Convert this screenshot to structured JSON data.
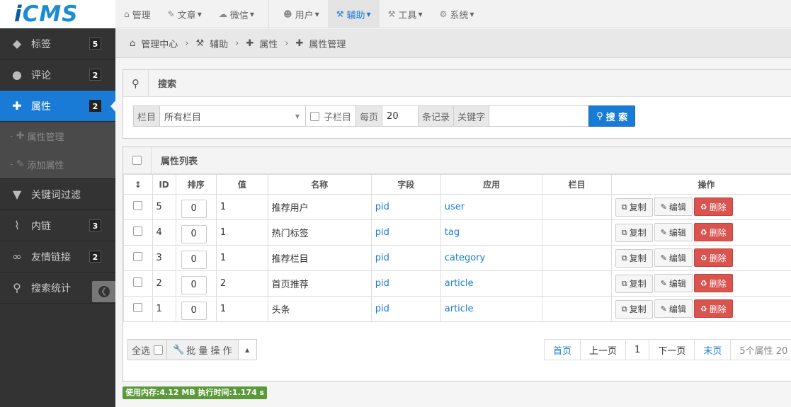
{
  "logo": {
    "text_i": "i",
    "text_cms": "CMS"
  },
  "nav": [
    {
      "icon": "home-icon",
      "glyph": "⌂",
      "label": "管理",
      "caret": false
    },
    {
      "icon": "edit-icon",
      "glyph": "✎",
      "label": "文章",
      "caret": true
    },
    {
      "icon": "wechat-icon",
      "glyph": "☁",
      "label": "微信",
      "caret": true
    },
    {
      "icon": "user-icon",
      "glyph": "☻",
      "label": "用户",
      "caret": true
    },
    {
      "icon": "gavel-icon",
      "glyph": "⚒",
      "label": "辅助",
      "caret": true,
      "active": true
    },
    {
      "icon": "tools-icon",
      "glyph": "⚒",
      "label": "工具",
      "caret": true
    },
    {
      "icon": "gear-icon",
      "glyph": "⚙",
      "label": "系统",
      "caret": true
    }
  ],
  "sidebar": {
    "items": [
      {
        "icon": "tags-icon",
        "glyph": "◆",
        "label": "标签",
        "badge": "5"
      },
      {
        "icon": "comments-icon",
        "glyph": "●",
        "label": "评论",
        "badge": "2"
      },
      {
        "icon": "puzzle-icon",
        "glyph": "✚",
        "label": "属性",
        "badge": "2",
        "active": true
      },
      {
        "icon": "filter-icon",
        "glyph": "▼",
        "label": "关键词过滤",
        "badge": ""
      },
      {
        "icon": "paperclip-icon",
        "glyph": "⌇",
        "label": "内链",
        "badge": "3"
      },
      {
        "icon": "link-icon",
        "glyph": "∞",
        "label": "友情链接",
        "badge": "2"
      },
      {
        "icon": "search-icon",
        "glyph": "⚲",
        "label": "搜索统计",
        "badge": ""
      }
    ],
    "sub": [
      {
        "icon": "puzzle-icon",
        "label": "属性管理"
      },
      {
        "icon": "edit-icon",
        "label": "添加属性"
      }
    ]
  },
  "breadcrumb": [
    {
      "icon": "home-icon",
      "glyph": "⌂",
      "label": "管理中心"
    },
    {
      "icon": "gavel-icon",
      "glyph": "⚒",
      "label": "辅助"
    },
    {
      "icon": "puzzle-icon",
      "glyph": "✚",
      "label": "属性"
    },
    {
      "icon": "puzzle-icon",
      "glyph": "✚",
      "label": "属性管理"
    }
  ],
  "search": {
    "title": "搜索",
    "category_label": "栏目",
    "category_value": "所有栏目",
    "subcat_label": "子栏目",
    "perpage_label": "每页",
    "perpage_value": "20",
    "records_label": "条记录",
    "keyword_label": "关键字",
    "keyword_value": "",
    "button_label": "搜 索"
  },
  "list": {
    "title": "属性列表",
    "columns": [
      "ID",
      "排序",
      "值",
      "名称",
      "字段",
      "应用",
      "栏目",
      "操作"
    ],
    "rows": [
      {
        "id": "5",
        "order": "0",
        "value": "1",
        "name": "推荐用户",
        "field": "pid",
        "app": "user",
        "category": ""
      },
      {
        "id": "4",
        "order": "0",
        "value": "1",
        "name": "热门标签",
        "field": "pid",
        "app": "tag",
        "category": ""
      },
      {
        "id": "3",
        "order": "0",
        "value": "1",
        "name": "推荐栏目",
        "field": "pid",
        "app": "category",
        "category": ""
      },
      {
        "id": "2",
        "order": "0",
        "value": "2",
        "name": "首页推荐",
        "field": "pid",
        "app": "article",
        "category": ""
      },
      {
        "id": "1",
        "order": "0",
        "value": "1",
        "name": "头条",
        "field": "pid",
        "app": "article",
        "category": ""
      }
    ],
    "actions": {
      "copy": "复制",
      "edit": "编辑",
      "delete": "删除"
    },
    "select_all": "全选",
    "batch": "批 量 操 作",
    "pager": {
      "first": "首页",
      "prev": "上一页",
      "current": "1",
      "next": "下一页",
      "last": "末页",
      "info": "5个属性 20"
    }
  },
  "status": "使用内存:4.12 MB 执行时间:1.174 s"
}
